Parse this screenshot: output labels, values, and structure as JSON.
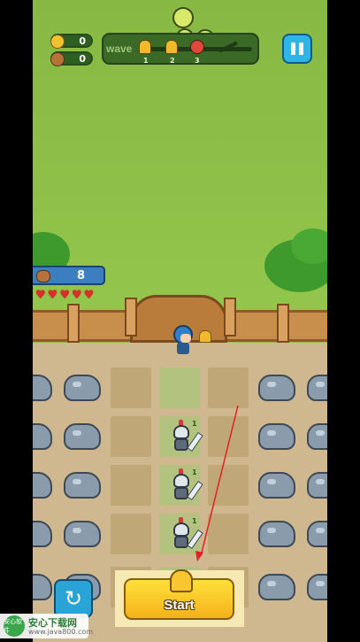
{
  "hud": {
    "coins": "0",
    "meat": "0",
    "wave_label": "wave",
    "wave_markers": [
      "1",
      "2",
      "3"
    ],
    "pause_icon": "pause-icon"
  },
  "player": {
    "power": "8",
    "hearts": 5
  },
  "board": {
    "knight_levels": [
      "1",
      "1",
      "1"
    ]
  },
  "actions": {
    "start_label": "Start",
    "refresh_icon": "refresh-icon"
  },
  "watermark": {
    "logo_text": "安心软件",
    "title": "安心下载网",
    "url": "www.java800.com"
  },
  "colors": {
    "accent_blue": "#2eb5e6",
    "start_yellow": "#ffe03a",
    "heart_red": "#e32a2a",
    "grass": "#8fbf47"
  }
}
